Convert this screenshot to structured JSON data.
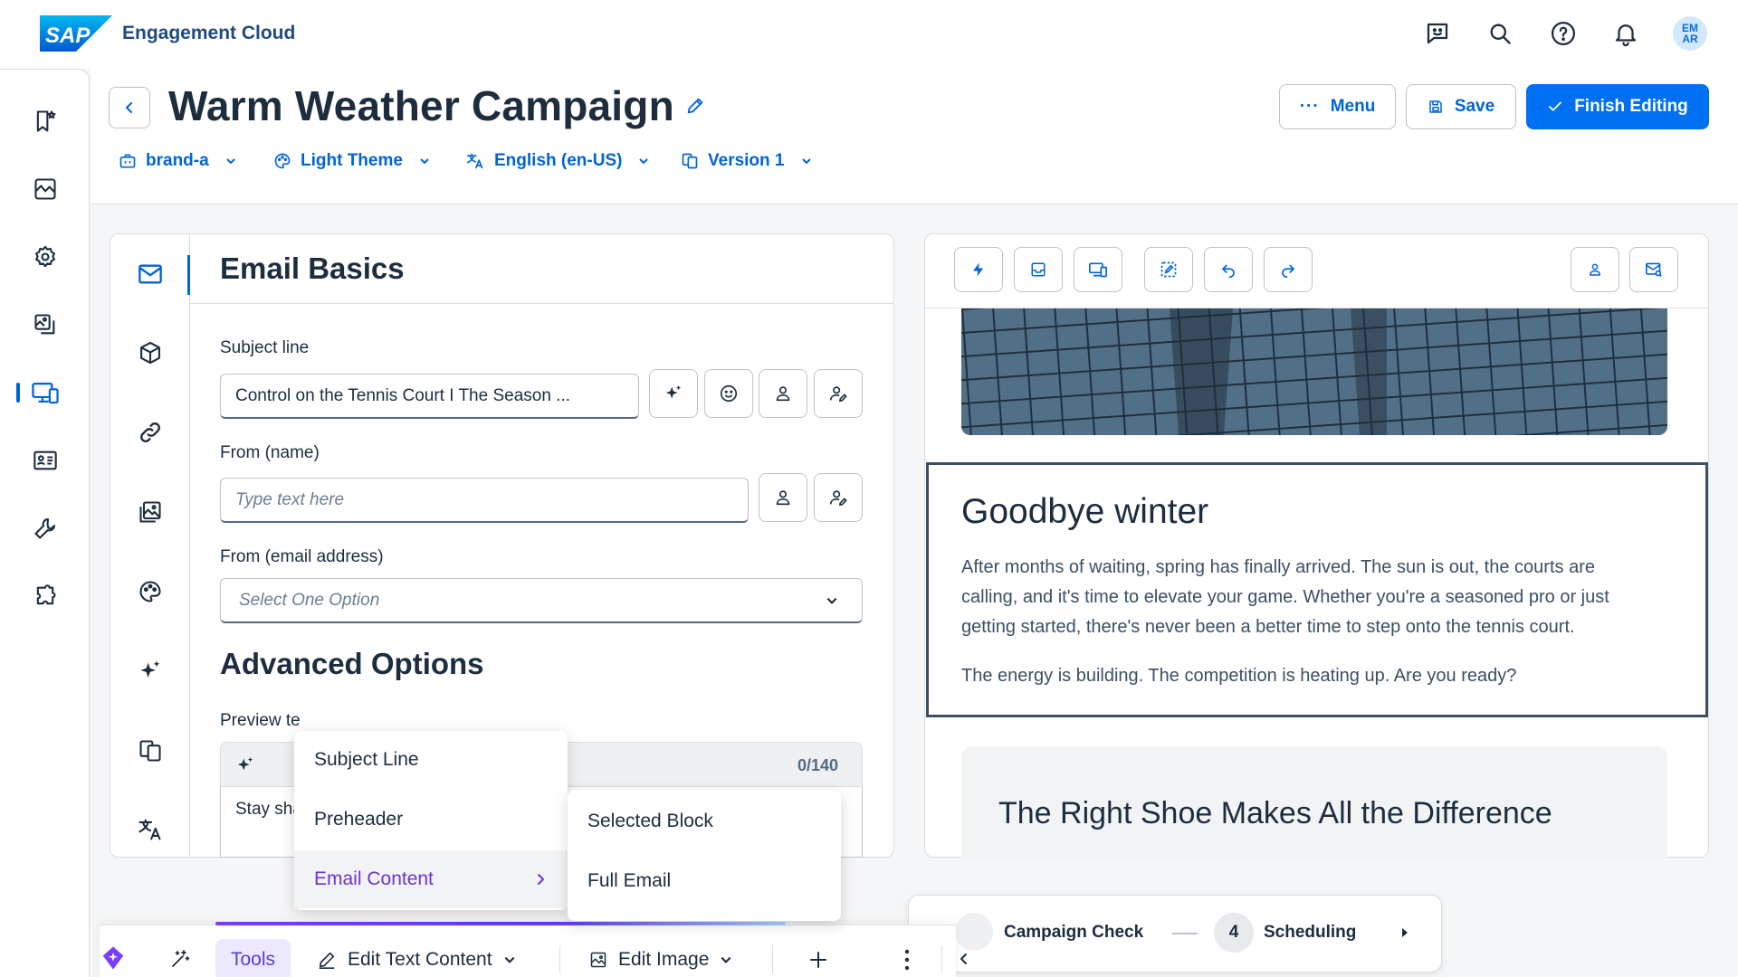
{
  "app": {
    "product": "Engagement Cloud",
    "logo_text": "SAP",
    "user_initials_top": "EM",
    "user_initials_bottom": "AR"
  },
  "shell_icons": [
    "feedback-icon",
    "search-icon",
    "help-icon",
    "notification-bell-icon"
  ],
  "sidenav": {
    "items": [
      "bookmark-star-icon",
      "analytics-icon",
      "settings-gear-icon",
      "content-gallery-icon",
      "campaign-devices-icon",
      "contacts-card-icon",
      "tools-wrench-icon",
      "extensions-puzzle-icon"
    ],
    "selected_index": 4
  },
  "header": {
    "title": "Warm Weather Campaign",
    "menu_label": "Menu",
    "save_label": "Save",
    "finish_label": "Finish Editing",
    "selectors": {
      "brand": "brand-a",
      "theme": "Light Theme",
      "language": "English (en-US)",
      "version": "Version 1"
    }
  },
  "editor": {
    "section_title": "Email Basics",
    "subject_label": "Subject line",
    "subject_value": "Control on the Tennis Court I The Season ...",
    "from_name_label": "From (name)",
    "from_name_placeholder": "Type text here",
    "from_email_label": "From (email address)",
    "from_email_placeholder": "Select One Option",
    "advanced_title": "Advanced Options",
    "preview_label_partial": "Preview te",
    "preview_counter": "0/140",
    "preview_value_partial": "Stay sha"
  },
  "ai_menu": {
    "items": [
      "Subject Line",
      "Preheader",
      "Email Content"
    ],
    "active_index": 2,
    "submenu": [
      "Selected Block",
      "Full Email"
    ]
  },
  "preview": {
    "block_title": "Goodbye winter",
    "paragraph_1_lines": [
      "After months of waiting, spring has finally arrived. The sun is out, the courts are",
      "calling, and it's time to elevate your game. Whether you're a seasoned pro or just",
      "getting started, there's never been a better time to step onto the tennis court."
    ],
    "paragraph_2": "The energy is building. The competition is heating up. Are you ready?",
    "next_block_title": "The Right Shoe Makes All the Difference"
  },
  "wizard": {
    "step_current_label": "Campaign Check",
    "step_next_number": "4",
    "step_next_label": "Scheduling"
  },
  "toolbar": {
    "tools_label": "Tools",
    "edit_text_label": "Edit Text Content",
    "edit_image_label": "Edit Image"
  },
  "colors": {
    "accent": "#0070f2",
    "brand_blue": "#0064d9",
    "ai_purple": "#6b35d6",
    "text": "#1d2d3e"
  }
}
